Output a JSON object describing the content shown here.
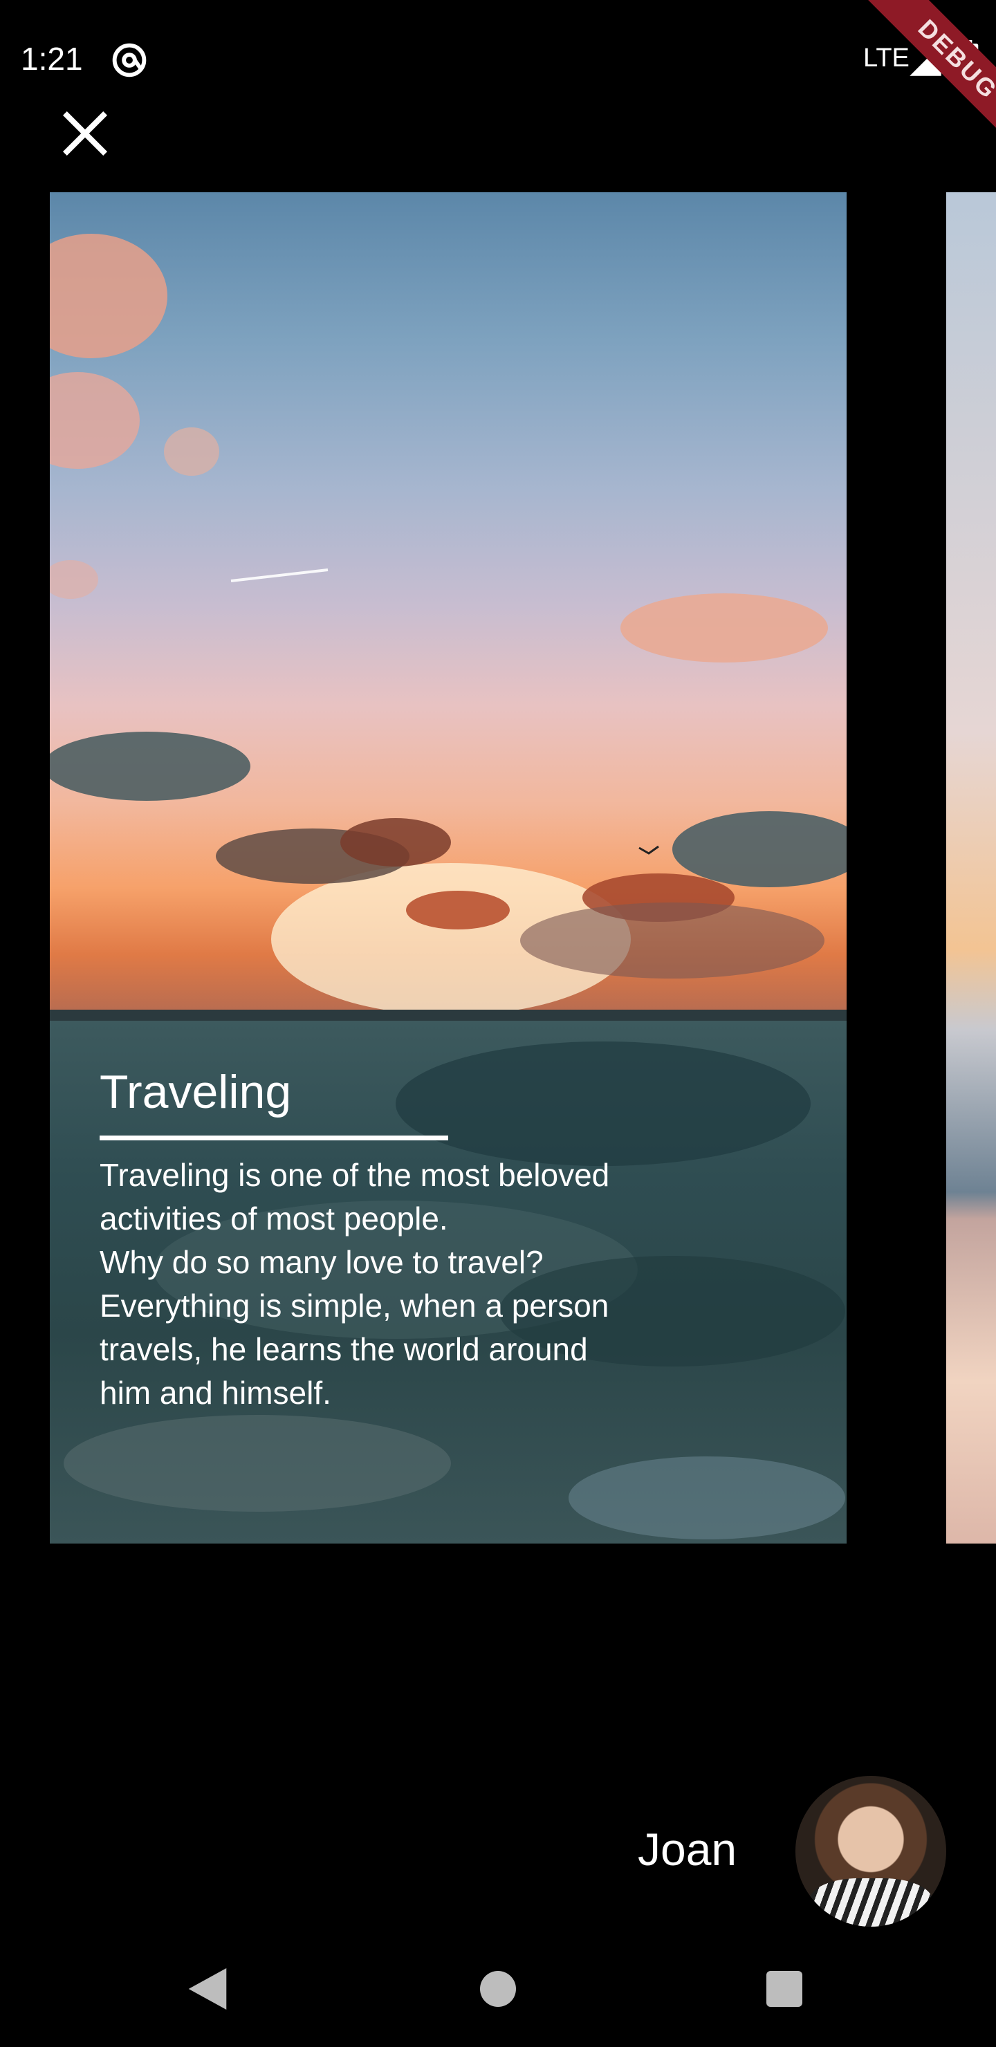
{
  "status_bar": {
    "time": "1:21",
    "network": "LTE",
    "debug_label": "DEBUG",
    "icons": [
      "at-sign-icon",
      "signal-icon",
      "battery-icon"
    ]
  },
  "toolbar": {
    "close_icon": "close-icon"
  },
  "story": {
    "title": "Traveling",
    "body_lines": [
      "Traveling is one of the most beloved",
      "activities of most people.",
      "Why do so many love to travel?",
      "Everything is simple, when a person",
      "travels, he learns the world around",
      "him and himself."
    ]
  },
  "author": {
    "name": "Joan"
  },
  "nav_bar": {
    "icons": [
      "back-icon",
      "home-icon",
      "recents-icon"
    ]
  },
  "colors": {
    "background": "#000000",
    "debug_banner": "#8e1a26",
    "text": "#ffffff",
    "nav_icons": "#bdbdbd"
  }
}
